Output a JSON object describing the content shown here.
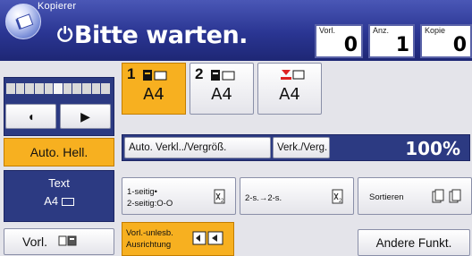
{
  "header": {
    "app_title": "Kopierer",
    "status": "Bitte warten.",
    "counters": [
      {
        "label": "Vorl.",
        "value": "0"
      },
      {
        "label": "Anz.",
        "value": "1"
      },
      {
        "label": "Kopie",
        "value": "0"
      }
    ]
  },
  "density": {
    "lighter_label": "◖",
    "darker_label": "▶",
    "auto_label": "Auto. Hell."
  },
  "text_mode": {
    "line1": "Text",
    "line2": "A4"
  },
  "original_button": {
    "label": "Vorl."
  },
  "trays": [
    {
      "number": "1",
      "size": "A4",
      "selected": true
    },
    {
      "number": "2",
      "size": "A4",
      "selected": false
    },
    {
      "number": "",
      "size": "A4",
      "selected": false
    }
  ],
  "reduce_enlarge": {
    "auto_label": "Auto. Verkl../Vergröß.",
    "manual_label": "Verk./Verg.",
    "zoom": "100%"
  },
  "duplex": {
    "one_to_two_line1": "1-seitig•",
    "one_to_two_line2": "2-seitig:O-O",
    "two_to_two": "2-s.→2-s.",
    "sort_label": "Sortieren"
  },
  "orientation": {
    "line1": "Vorl.-unlesb.",
    "line2": "Ausrichtung"
  },
  "other_functions": {
    "label": "Andere Funkt."
  },
  "colors": {
    "header_blue": "#2a3592",
    "accent_orange": "#f7b020",
    "panel_grey": "#e4e4ea"
  }
}
